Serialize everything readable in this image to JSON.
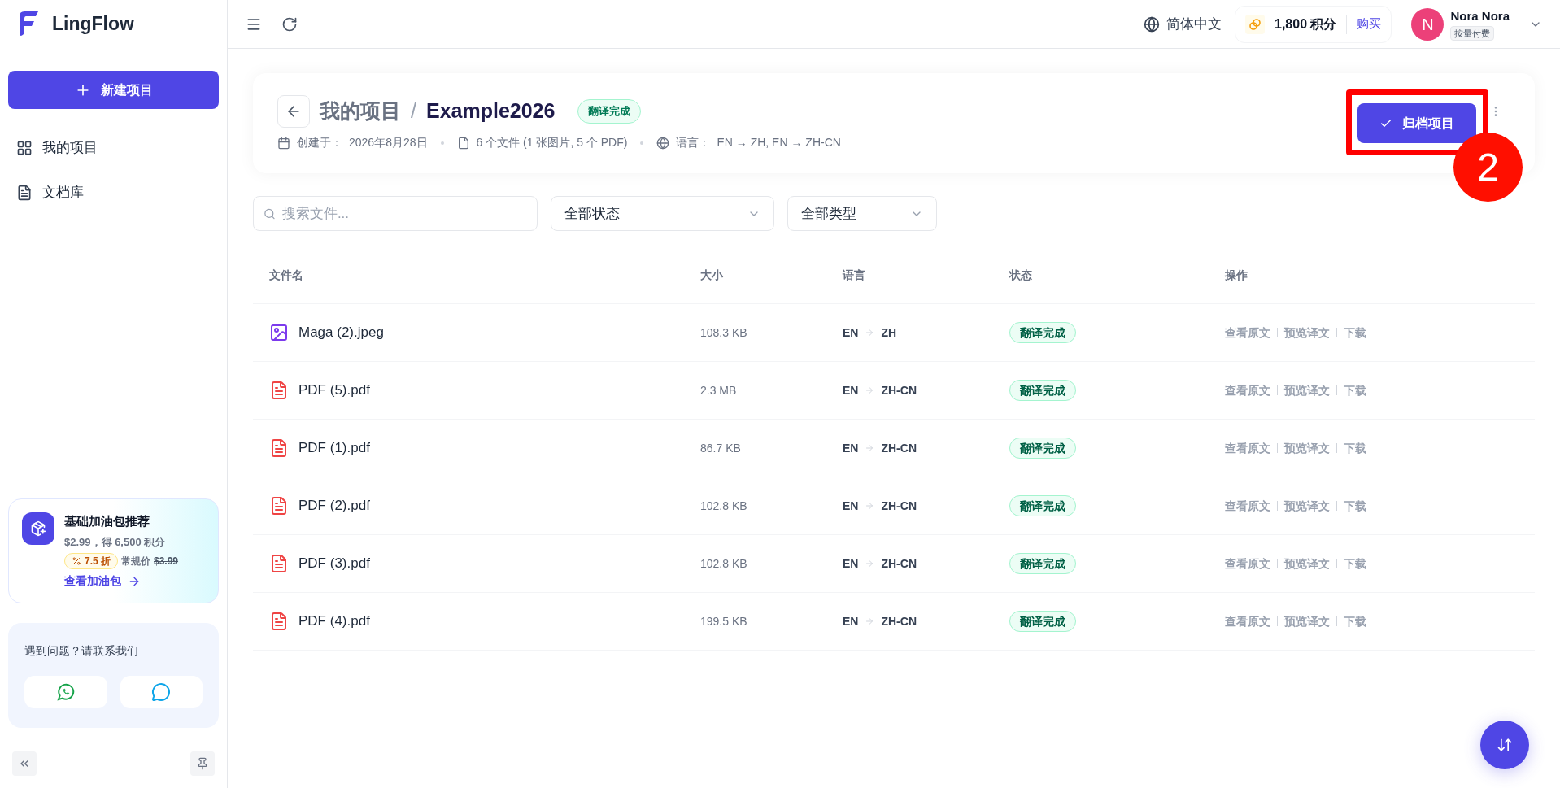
{
  "app": {
    "name": "LingFlow"
  },
  "sidebar": {
    "new_button": "新建项目",
    "items": [
      {
        "label": "我的项目",
        "selected": false
      },
      {
        "label": "文档库",
        "selected": false
      }
    ],
    "promo": {
      "title": "基础加油包推荐",
      "subtitle": "$2.99，得 6,500 积分",
      "discount": "7.5 折",
      "regular_label": "常规价",
      "regular_price": "$3.99",
      "link": "查看加油包"
    },
    "help": {
      "text": "遇到问题？请联系我们"
    }
  },
  "header": {
    "language": "简体中文",
    "credits": "1,800 积分",
    "buy": "购买",
    "user": {
      "initial": "N",
      "name": "Nora Nora",
      "plan": "按量付费"
    }
  },
  "project": {
    "parent": "我的项目",
    "separator": "/",
    "name": "Example2026",
    "status": "翻译完成",
    "created_label": "创建于：",
    "created": "2026年8月28日",
    "files": "6 个文件 (1 张图片, 5 个 PDF)",
    "language_label": "语言：",
    "languages": "EN → ZH, EN → ZH-CN",
    "archive_button": "归档项目"
  },
  "annotation": {
    "step": "2"
  },
  "filters": {
    "search_placeholder": "搜索文件...",
    "status": "全部状态",
    "type": "全部类型"
  },
  "table": {
    "columns": [
      "文件名",
      "大小",
      "语言",
      "状态",
      "操作"
    ],
    "rows": [
      {
        "kind": "image",
        "name": "Maga (2).jpeg",
        "size": "108.3 KB",
        "source": "EN",
        "target": "ZH",
        "status": "翻译完成",
        "actions": [
          "查看原文",
          "预览译文",
          "下载"
        ]
      },
      {
        "kind": "pdf",
        "name": "PDF (5).pdf",
        "size": "2.3 MB",
        "source": "EN",
        "target": "ZH-CN",
        "status": "翻译完成",
        "actions": [
          "查看原文",
          "预览译文",
          "下载"
        ]
      },
      {
        "kind": "pdf",
        "name": "PDF (1).pdf",
        "size": "86.7 KB",
        "source": "EN",
        "target": "ZH-CN",
        "status": "翻译完成",
        "actions": [
          "查看原文",
          "预览译文",
          "下载"
        ]
      },
      {
        "kind": "pdf",
        "name": "PDF (2).pdf",
        "size": "102.8 KB",
        "source": "EN",
        "target": "ZH-CN",
        "status": "翻译完成",
        "actions": [
          "查看原文",
          "预览译文",
          "下载"
        ]
      },
      {
        "kind": "pdf",
        "name": "PDF (3).pdf",
        "size": "102.8 KB",
        "source": "EN",
        "target": "ZH-CN",
        "status": "翻译完成",
        "actions": [
          "查看原文",
          "预览译文",
          "下载"
        ]
      },
      {
        "kind": "pdf",
        "name": "PDF (4).pdf",
        "size": "199.5 KB",
        "source": "EN",
        "target": "ZH-CN",
        "status": "翻译完成",
        "actions": [
          "查看原文",
          "预览译文",
          "下载"
        ]
      }
    ]
  }
}
